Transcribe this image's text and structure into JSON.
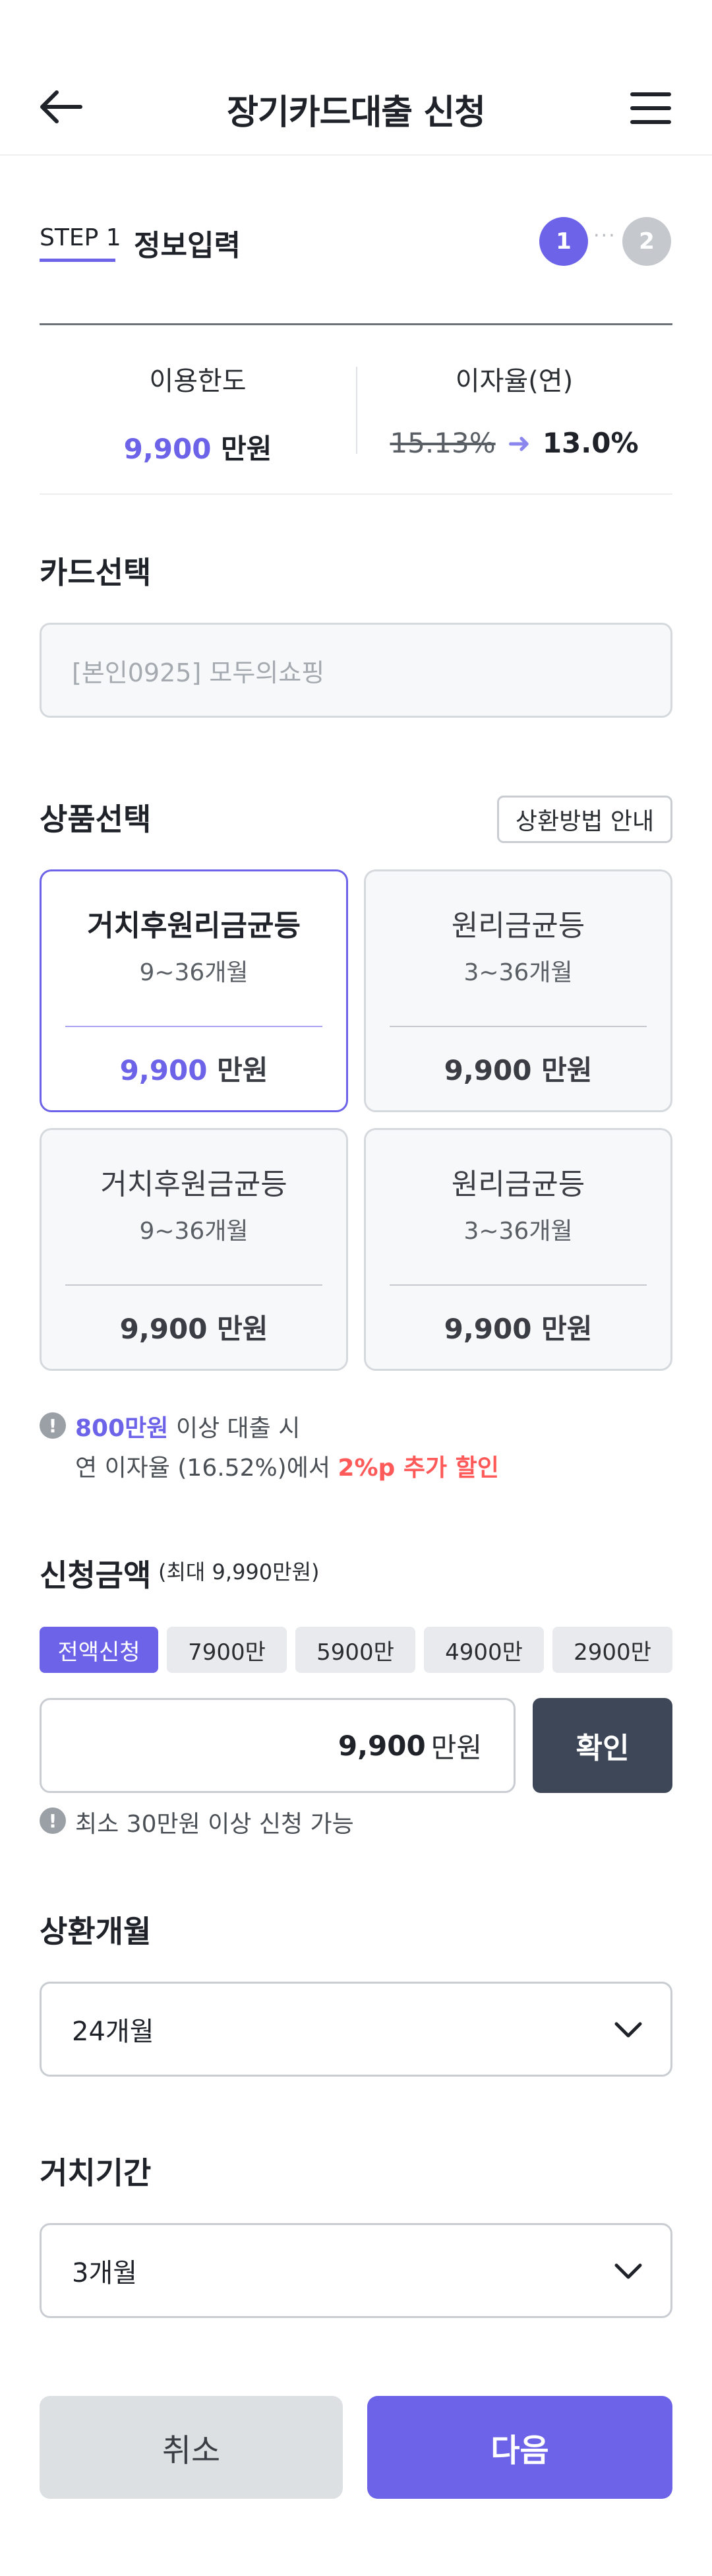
{
  "header": {
    "title": "장기카드대출 신청",
    "back_icon": "arrow-left-icon",
    "menu_icon": "hamburger-menu-icon"
  },
  "step": {
    "label": "STEP 1",
    "title": "정보입력",
    "step1": "1",
    "step2": "2",
    "dots": "···"
  },
  "summary": {
    "limit_label": "이용한도",
    "limit_value": "9,900",
    "limit_unit": "만원",
    "rate_label": "이자율(연)",
    "rate_old": "15.13%",
    "rate_arrow": "➜",
    "rate_new": "13.0%"
  },
  "card_section": {
    "title": "카드선택",
    "selected_card": "[본인0925] 모두의쇼핑"
  },
  "product_section": {
    "title": "상품선택",
    "guide_button": "상환방법 안내",
    "products": [
      {
        "name": "거치후원리금균등",
        "term": "9~36개월",
        "amount": "9,900",
        "unit": "만원",
        "selected": true
      },
      {
        "name": "원리금균등",
        "term": "3~36개월",
        "amount": "9,900",
        "unit": "만원",
        "selected": false
      },
      {
        "name": "거치후원금균등",
        "term": "9~36개월",
        "amount": "9,900",
        "unit": "만원",
        "selected": false
      },
      {
        "name": "원리금균등",
        "term": "3~36개월",
        "amount": "9,900",
        "unit": "만원",
        "selected": false
      }
    ]
  },
  "discount_info": {
    "icon": "!",
    "highlight": "800만원",
    "line1_rest": " 이상 대출 시",
    "line2_prefix": "연 이자율 (16.52%)에서 ",
    "line2_red": "2%p 추가 할인"
  },
  "amount_section": {
    "title": "신청금액",
    "max_note": "(최대 9,990만원)",
    "chips": [
      "전액신청",
      "7900만",
      "5900만",
      "4900만",
      "2900만"
    ],
    "active_chip": 0,
    "input_value": "9,900",
    "input_unit": "만원",
    "confirm_button": "확인",
    "min_note_icon": "!",
    "min_note": "최소 30만원 이상 신청 가능"
  },
  "repay_section": {
    "title": "상환개월",
    "value": "24개월",
    "icon": "chevron-down-icon"
  },
  "grace_section": {
    "title": "거치기간",
    "value": "3개월",
    "icon": "chevron-down-icon"
  },
  "footer": {
    "cancel": "취소",
    "next": "다음"
  },
  "colors": {
    "accent": "#6c63e8",
    "red": "#ff5a5a",
    "dark_button": "#3d4757",
    "gray_button": "#dde0e2"
  }
}
